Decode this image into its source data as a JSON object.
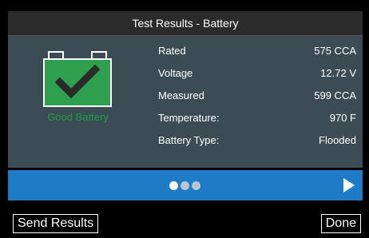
{
  "title": "Test Results - Battery",
  "status": {
    "label": "Good Battery",
    "icon": "battery-check-icon",
    "color": "#1e9a4a"
  },
  "results": [
    {
      "label": "Rated",
      "value": "575 CCA"
    },
    {
      "label": "Voltage",
      "value": "12.72 V"
    },
    {
      "label": "Measured",
      "value": "599 CCA"
    },
    {
      "label": "Temperature:",
      "value": "970 F"
    },
    {
      "label": "Battery Type:",
      "value": "Flooded"
    }
  ],
  "pager": {
    "pages": 3,
    "current": 1,
    "next_icon": "play-right-icon"
  },
  "footer": {
    "send_label": "Send Results",
    "done_label": "Done"
  },
  "colors": {
    "accent": "#1e7cc6",
    "panel": "#3c4c54",
    "good": "#1e9a4a"
  }
}
